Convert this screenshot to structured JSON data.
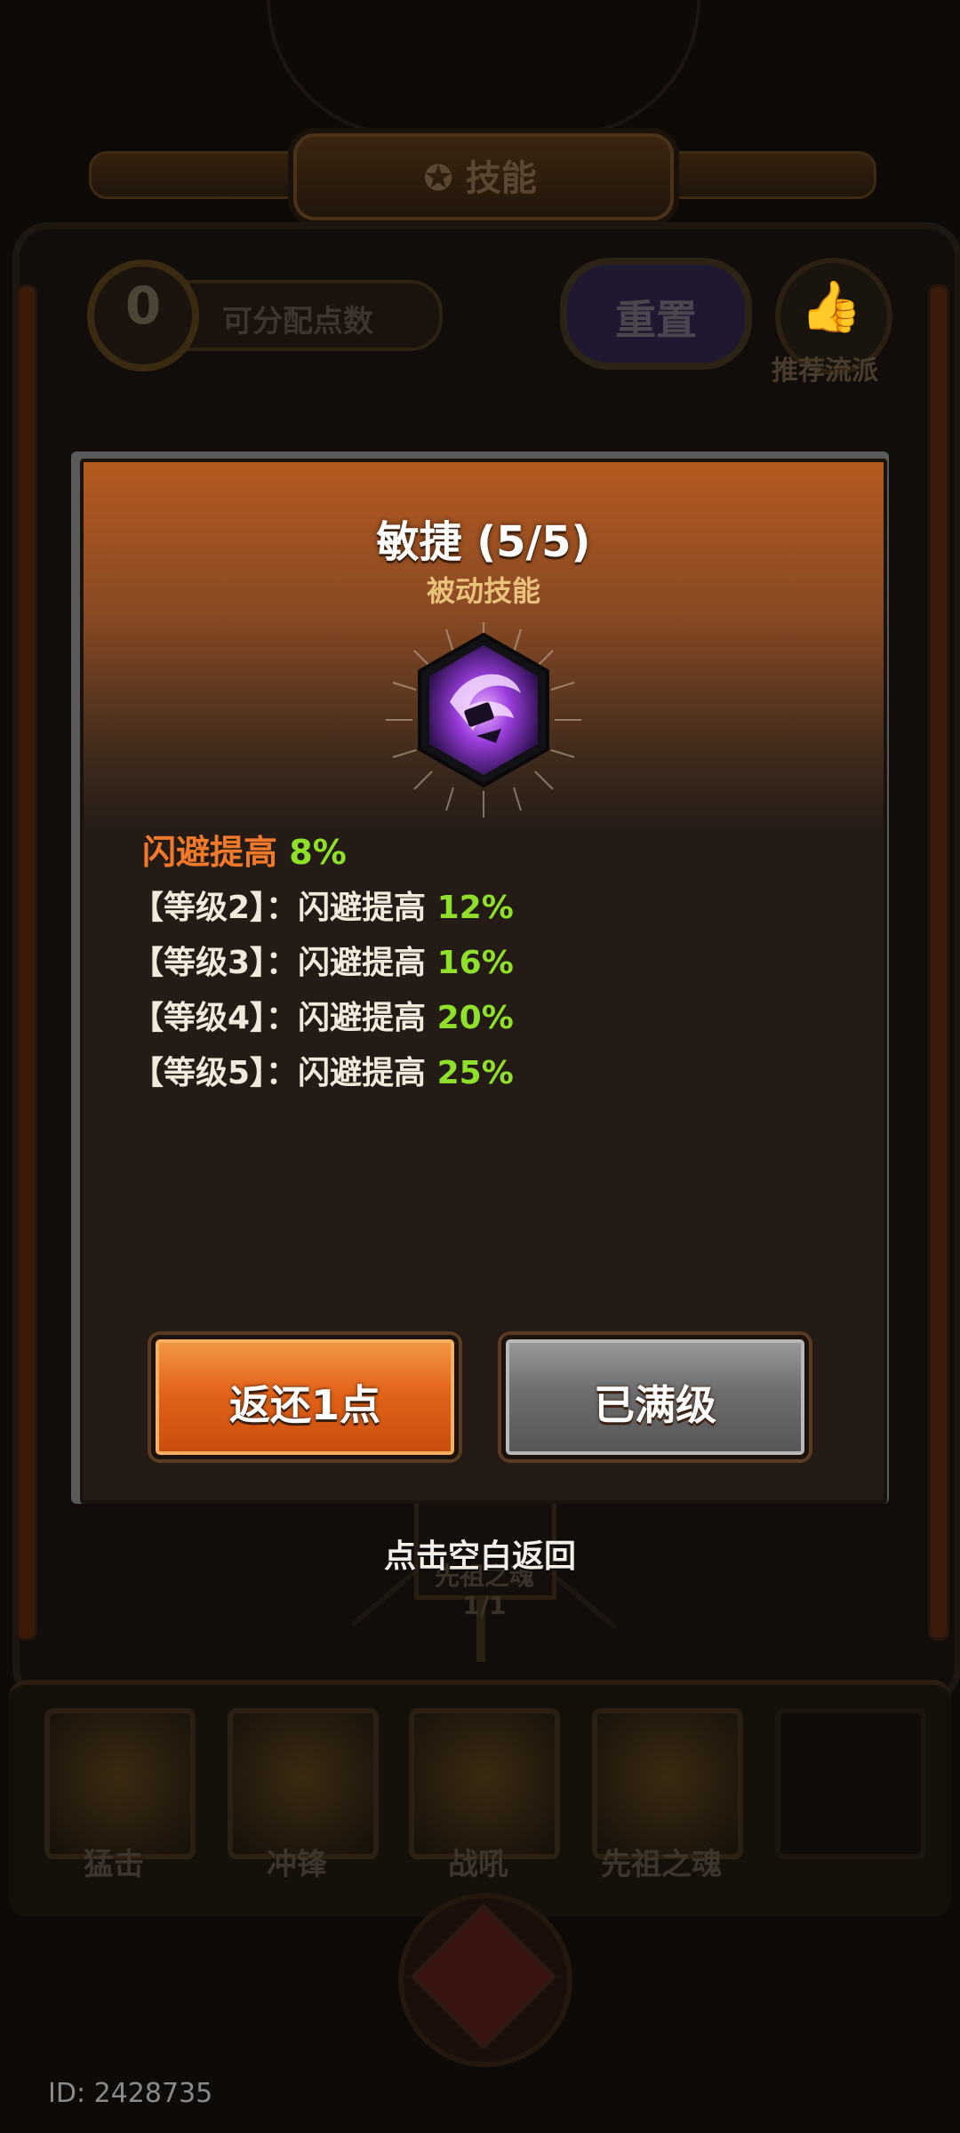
{
  "header": {
    "title": "技能",
    "title_icon": "gear-wheel-icon"
  },
  "points": {
    "value": "0",
    "label": "可分配点数"
  },
  "reset": {
    "label": "重置"
  },
  "recommend": {
    "label": "推荐流派",
    "icon": "thumbs-up-icon"
  },
  "tree": {
    "node_label": "先祖之魂",
    "node_count": "1/1"
  },
  "skill_bar": [
    {
      "label": "猛击"
    },
    {
      "label": "冲锋"
    },
    {
      "label": "战吼"
    },
    {
      "label": "先祖之魂"
    },
    {
      "label": ""
    }
  ],
  "modal": {
    "title": "敏捷 (5/5)",
    "subtitle": "被动技能",
    "icon": "agility-swirl-icon",
    "main_effect": {
      "text": "闪避提高",
      "value": "8%"
    },
    "levels": [
      {
        "prefix": "【等级2】：闪避提高",
        "value": "12%"
      },
      {
        "prefix": "【等级3】：闪避提高",
        "value": "16%"
      },
      {
        "prefix": "【等级4】：闪避提高",
        "value": "20%"
      },
      {
        "prefix": "【等级5】：闪避提高",
        "value": "25%"
      }
    ],
    "return_button": "返还1点",
    "maxed_button": "已满级"
  },
  "hint": "点击空白返回",
  "id_label": "ID: 2428735",
  "colors": {
    "accent_orange": "#f07a2a",
    "value_green": "#8ee02a",
    "modal_bg": "#241b16"
  }
}
